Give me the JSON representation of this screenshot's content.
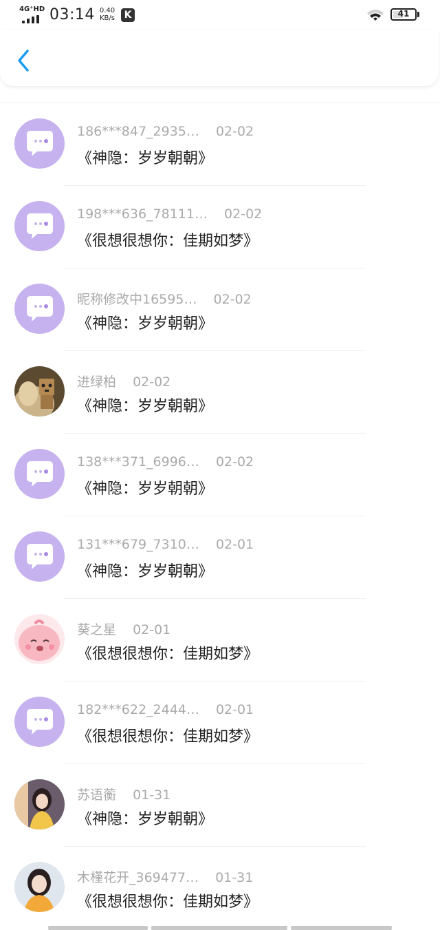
{
  "status_bar": {
    "network": "4G⁺HD",
    "time": "03:14",
    "speed_value": "0.40",
    "speed_unit": "KB/s",
    "app_badge": "K",
    "battery": "41"
  },
  "header": {
    "back_icon": "chevron-left-icon"
  },
  "messages": [
    {
      "name": "186***847_2935…",
      "date": "02-02",
      "title": "《神隐：岁岁朝朝》",
      "avatar": "default-chat-avatar"
    },
    {
      "name": "198***636_78111…",
      "date": "02-02",
      "title": "《很想很想你：佳期如梦》",
      "avatar": "default-chat-avatar"
    },
    {
      "name": "昵称修改中16595…",
      "date": "02-02",
      "title": "《神隐：岁岁朝朝》",
      "avatar": "default-chat-avatar"
    },
    {
      "name": "进绿柏",
      "date": "02-02",
      "title": "《神隐：岁岁朝朝》",
      "avatar": "photo-avatar-danbo"
    },
    {
      "name": "138***371_6996…",
      "date": "02-02",
      "title": "《神隐：岁岁朝朝》",
      "avatar": "default-chat-avatar"
    },
    {
      "name": "131***679_7310…",
      "date": "02-01",
      "title": "《神隐：岁岁朝朝》",
      "avatar": "default-chat-avatar"
    },
    {
      "name": "葵之星",
      "date": "02-01",
      "title": "《很想很想你：佳期如梦》",
      "avatar": "photo-avatar-pink-cartoon"
    },
    {
      "name": "182***622_2444…",
      "date": "02-01",
      "title": "《很想很想你：佳期如梦》",
      "avatar": "default-chat-avatar"
    },
    {
      "name": "苏语蘅",
      "date": "01-31",
      "title": "《神隐：岁岁朝朝》",
      "avatar": "photo-avatar-girl-yellow"
    },
    {
      "name": "木槿花开_369477…",
      "date": "01-31",
      "title": "《很想很想你：佳期如梦》",
      "avatar": "photo-avatar-girl-orange"
    }
  ],
  "colors": {
    "accent": "#1a9bf0",
    "default_avatar_bg": "#c6b2ef",
    "meta_text": "#aaaaaa",
    "title_text": "#222222"
  }
}
